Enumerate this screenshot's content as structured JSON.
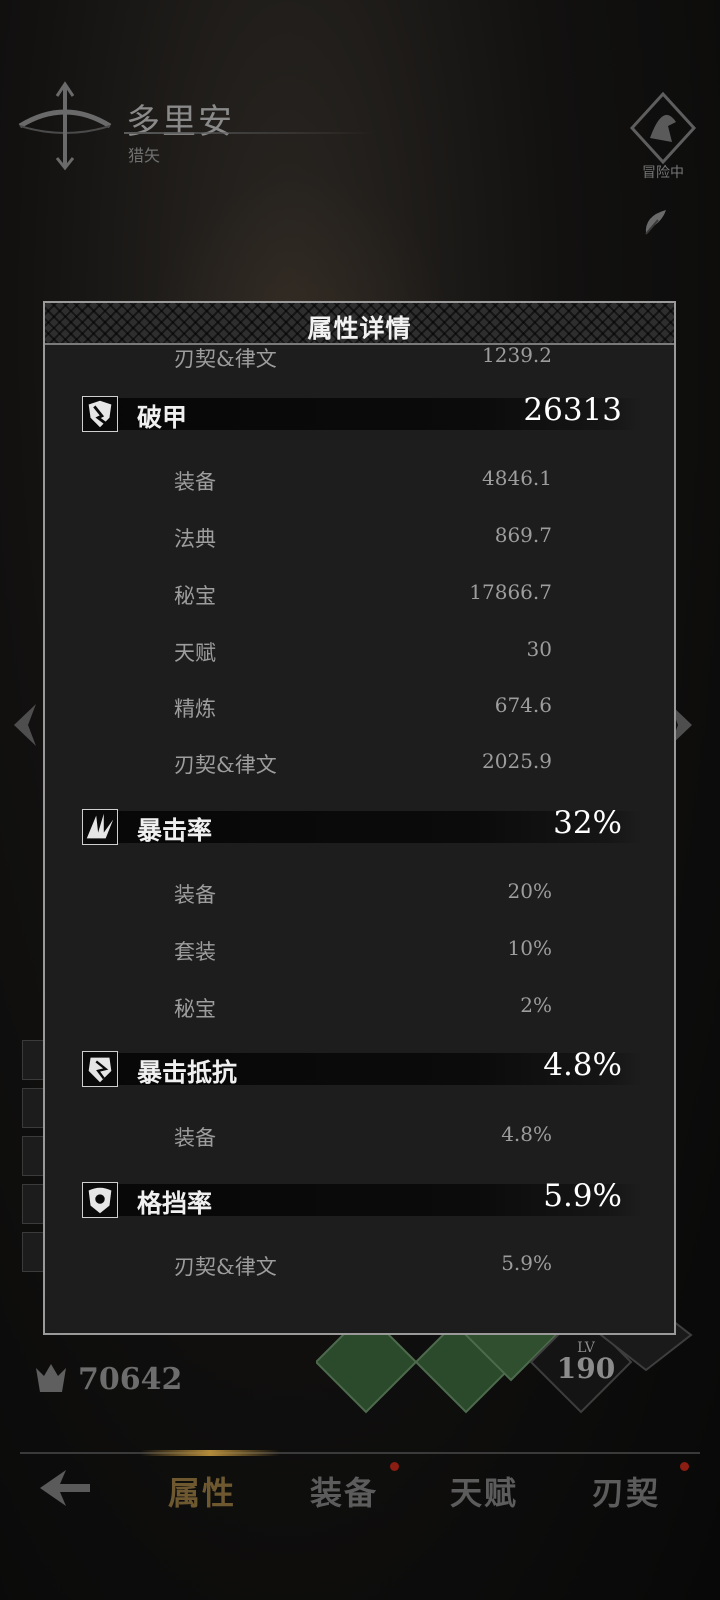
{
  "character": {
    "name": "多里安",
    "class": "猎矢",
    "crest_label": "冒险中"
  },
  "power": {
    "value": "70642"
  },
  "level": {
    "prefix": "LV",
    "value": "190"
  },
  "tabs": [
    {
      "label": "属性",
      "active": true
    },
    {
      "label": "装备",
      "active": false,
      "has_dot": true
    },
    {
      "label": "天赋",
      "active": false
    },
    {
      "label": "刃契",
      "active": false,
      "has_dot": true
    }
  ],
  "panel": {
    "title": "属性详情",
    "top_partial": {
      "label": "刃契&律文",
      "value": "1239.2"
    },
    "stats": [
      {
        "icon": "armor-break-icon",
        "label": "破甲",
        "value": "26313",
        "breakdown": [
          {
            "label": "装备",
            "value": "4846.1"
          },
          {
            "label": "法典",
            "value": "869.7"
          },
          {
            "label": "秘宝",
            "value": "17866.7"
          },
          {
            "label": "天赋",
            "value": "30"
          },
          {
            "label": "精炼",
            "value": "674.6"
          },
          {
            "label": "刃契&律文",
            "value": "2025.9"
          }
        ]
      },
      {
        "icon": "crit-rate-icon",
        "label": "暴击率",
        "value": "32%",
        "breakdown": [
          {
            "label": "装备",
            "value": "20%"
          },
          {
            "label": "套装",
            "value": "10%"
          },
          {
            "label": "秘宝",
            "value": "2%"
          }
        ]
      },
      {
        "icon": "crit-resist-icon",
        "label": "暴击抵抗",
        "value": "4.8%",
        "breakdown": [
          {
            "label": "装备",
            "value": "4.8%"
          }
        ]
      },
      {
        "icon": "block-rate-icon",
        "label": "格挡率",
        "value": "5.9%",
        "breakdown": [
          {
            "label": "刃契&律文",
            "value": "5.9%"
          }
        ]
      }
    ]
  },
  "colors": {
    "panel_bg": "#1d1d1d",
    "panel_border": "#9a9a9a",
    "active_tab": "#6e5830",
    "notification_dot": "#8b1d12"
  }
}
